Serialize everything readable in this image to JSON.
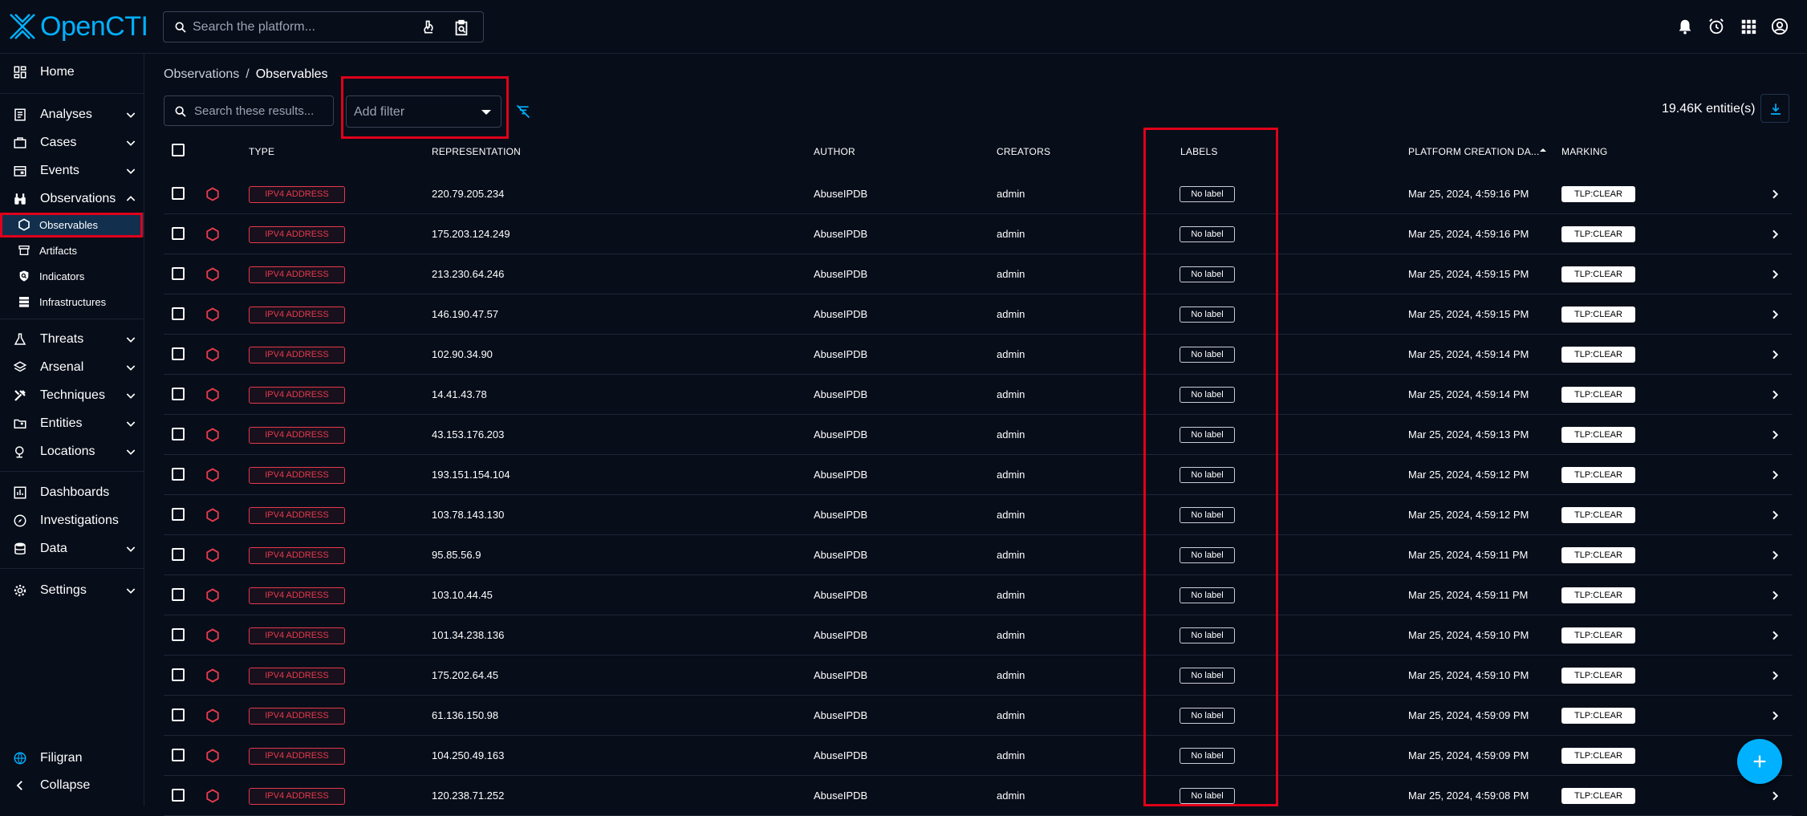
{
  "app": {
    "logo_text": "OpenCTI",
    "brand_color": "#00b1ff"
  },
  "topbar": {
    "search_placeholder": "Search the platform...",
    "icons": [
      "notifications-icon",
      "alarm-icon",
      "apps-icon",
      "account-icon"
    ]
  },
  "sidebar": {
    "home": "Home",
    "analyses": "Analyses",
    "cases": "Cases",
    "events": "Events",
    "observations": "Observations",
    "observables": "Observables",
    "artifacts": "Artifacts",
    "indicators": "Indicators",
    "infrastructures": "Infrastructures",
    "threats": "Threats",
    "arsenal": "Arsenal",
    "techniques": "Techniques",
    "entities": "Entities",
    "locations": "Locations",
    "dashboards": "Dashboards",
    "investigations": "Investigations",
    "data": "Data",
    "settings": "Settings",
    "filigran": "Filigran",
    "collapse": "Collapse"
  },
  "main": {
    "breadcrumb": {
      "parent": "Observations",
      "separator": "/",
      "current": "Observables"
    },
    "search_placeholder": "Search these results...",
    "add_filter": "Add filter",
    "entity_count": "19.46K entitie(s)"
  },
  "table": {
    "headers": {
      "type": "TYPE",
      "representation": "REPRESENTATION",
      "author": "AUTHOR",
      "creators": "CREATORS",
      "labels": "LABELS",
      "created": "PLATFORM CREATION DA...",
      "marking": "MARKING"
    },
    "sort_column": "PLATFORM CREATION DA...",
    "sort_direction": "ascending",
    "rows": [
      {
        "type": "IPV4 ADDRESS",
        "representation": "220.79.205.234",
        "author": "AbuseIPDB",
        "creator": "admin",
        "label": "No label",
        "created": "Mar 25, 2024, 4:59:16 PM",
        "marking": "TLP:CLEAR"
      },
      {
        "type": "IPV4 ADDRESS",
        "representation": "175.203.124.249",
        "author": "AbuseIPDB",
        "creator": "admin",
        "label": "No label",
        "created": "Mar 25, 2024, 4:59:16 PM",
        "marking": "TLP:CLEAR"
      },
      {
        "type": "IPV4 ADDRESS",
        "representation": "213.230.64.246",
        "author": "AbuseIPDB",
        "creator": "admin",
        "label": "No label",
        "created": "Mar 25, 2024, 4:59:15 PM",
        "marking": "TLP:CLEAR"
      },
      {
        "type": "IPV4 ADDRESS",
        "representation": "146.190.47.57",
        "author": "AbuseIPDB",
        "creator": "admin",
        "label": "No label",
        "created": "Mar 25, 2024, 4:59:15 PM",
        "marking": "TLP:CLEAR"
      },
      {
        "type": "IPV4 ADDRESS",
        "representation": "102.90.34.90",
        "author": "AbuseIPDB",
        "creator": "admin",
        "label": "No label",
        "created": "Mar 25, 2024, 4:59:14 PM",
        "marking": "TLP:CLEAR"
      },
      {
        "type": "IPV4 ADDRESS",
        "representation": "14.41.43.78",
        "author": "AbuseIPDB",
        "creator": "admin",
        "label": "No label",
        "created": "Mar 25, 2024, 4:59:14 PM",
        "marking": "TLP:CLEAR"
      },
      {
        "type": "IPV4 ADDRESS",
        "representation": "43.153.176.203",
        "author": "AbuseIPDB",
        "creator": "admin",
        "label": "No label",
        "created": "Mar 25, 2024, 4:59:13 PM",
        "marking": "TLP:CLEAR"
      },
      {
        "type": "IPV4 ADDRESS",
        "representation": "193.151.154.104",
        "author": "AbuseIPDB",
        "creator": "admin",
        "label": "No label",
        "created": "Mar 25, 2024, 4:59:12 PM",
        "marking": "TLP:CLEAR"
      },
      {
        "type": "IPV4 ADDRESS",
        "representation": "103.78.143.130",
        "author": "AbuseIPDB",
        "creator": "admin",
        "label": "No label",
        "created": "Mar 25, 2024, 4:59:12 PM",
        "marking": "TLP:CLEAR"
      },
      {
        "type": "IPV4 ADDRESS",
        "representation": "95.85.56.9",
        "author": "AbuseIPDB",
        "creator": "admin",
        "label": "No label",
        "created": "Mar 25, 2024, 4:59:11 PM",
        "marking": "TLP:CLEAR"
      },
      {
        "type": "IPV4 ADDRESS",
        "representation": "103.10.44.45",
        "author": "AbuseIPDB",
        "creator": "admin",
        "label": "No label",
        "created": "Mar 25, 2024, 4:59:11 PM",
        "marking": "TLP:CLEAR"
      },
      {
        "type": "IPV4 ADDRESS",
        "representation": "101.34.238.136",
        "author": "AbuseIPDB",
        "creator": "admin",
        "label": "No label",
        "created": "Mar 25, 2024, 4:59:10 PM",
        "marking": "TLP:CLEAR"
      },
      {
        "type": "IPV4 ADDRESS",
        "representation": "175.202.64.45",
        "author": "AbuseIPDB",
        "creator": "admin",
        "label": "No label",
        "created": "Mar 25, 2024, 4:59:10 PM",
        "marking": "TLP:CLEAR"
      },
      {
        "type": "IPV4 ADDRESS",
        "representation": "61.136.150.98",
        "author": "AbuseIPDB",
        "creator": "admin",
        "label": "No label",
        "created": "Mar 25, 2024, 4:59:09 PM",
        "marking": "TLP:CLEAR"
      },
      {
        "type": "IPV4 ADDRESS",
        "representation": "104.250.49.163",
        "author": "AbuseIPDB",
        "creator": "admin",
        "label": "No label",
        "created": "Mar 25, 2024, 4:59:09 PM",
        "marking": "TLP:CLEAR"
      },
      {
        "type": "IPV4 ADDRESS",
        "representation": "120.238.71.252",
        "author": "AbuseIPDB",
        "creator": "admin",
        "label": "No label",
        "created": "Mar 25, 2024, 4:59:08 PM",
        "marking": "TLP:CLEAR"
      }
    ]
  }
}
